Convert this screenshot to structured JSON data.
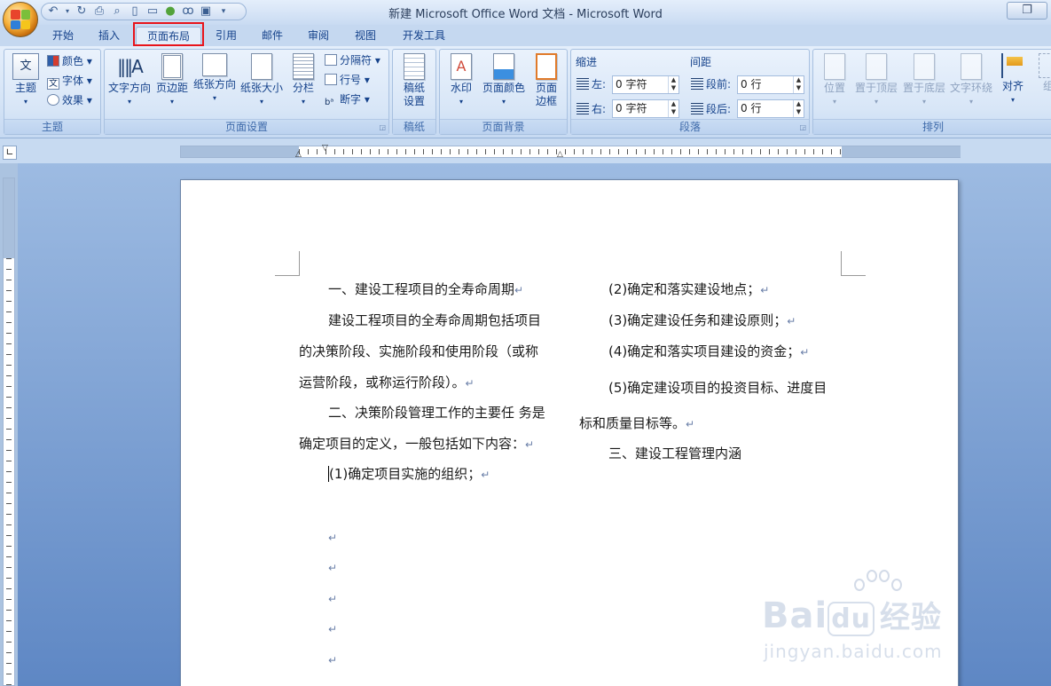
{
  "window": {
    "title": "新建 Microsoft Office Word 文档 - Microsoft Word"
  },
  "tabs": [
    "开始",
    "插入",
    "页面布局",
    "引用",
    "邮件",
    "审阅",
    "视图",
    "开发工具"
  ],
  "active_tab": "页面布局",
  "ribbon": {
    "theme": {
      "label": "主题",
      "main": "主题",
      "colors": "颜色",
      "fonts": "字体",
      "effects": "效果"
    },
    "page_setup": {
      "label": "页面设置",
      "text_direction": "文字方向",
      "margins": "页边距",
      "orientation": "纸张方向",
      "size": "纸张大小",
      "columns": "分栏",
      "breaks": "分隔符",
      "line_numbers": "行号",
      "hyphenation": "断字"
    },
    "draft": {
      "label": "稿纸",
      "setup_line1": "稿纸",
      "setup_line2": "设置"
    },
    "background": {
      "label": "页面背景",
      "watermark": "水印",
      "page_color": "页面颜色",
      "border_line1": "页面",
      "border_line2": "边框"
    },
    "paragraph": {
      "label": "段落",
      "indent_title": "缩进",
      "spacing_title": "间距",
      "left_label": "左:",
      "right_label": "右:",
      "before_label": "段前:",
      "after_label": "段后:",
      "indent_left": "0 字符",
      "indent_right": "0 字符",
      "space_before": "0 行",
      "space_after": "0 行"
    },
    "arrange": {
      "label": "排列",
      "position": "位置",
      "bring_front": "置于顶层",
      "send_back": "置于底层",
      "wrap": "文字环绕",
      "align": "对齐",
      "group": "组"
    }
  },
  "document": {
    "left_col": [
      "一、建设工程项目的全寿命周期",
      "建设工程项目的全寿命周期包括项目",
      "的决策阶段、实施阶段和使用阶段（或称",
      "运营阶段，或称运行阶段）。",
      "二、决策阶段管理工作的主要任  务是",
      "确定项目的定义，一般包括如下内容：",
      "(1)确定项目实施的组织；"
    ],
    "right_col": [
      "(2)确定和落实建设地点；",
      "(3)确定建设任务和建设原则；",
      "(4)确定和落实项目建设的资金；",
      "(5)确定建设项目的投资目标、进度目",
      "标和质量目标等。",
      "三、建设工程管理内涵"
    ],
    "para_mark": "↵"
  },
  "watermark": {
    "brand": "Bai",
    "brand2": "du",
    "cn": "经验",
    "url": "jingyan.baidu.com"
  }
}
